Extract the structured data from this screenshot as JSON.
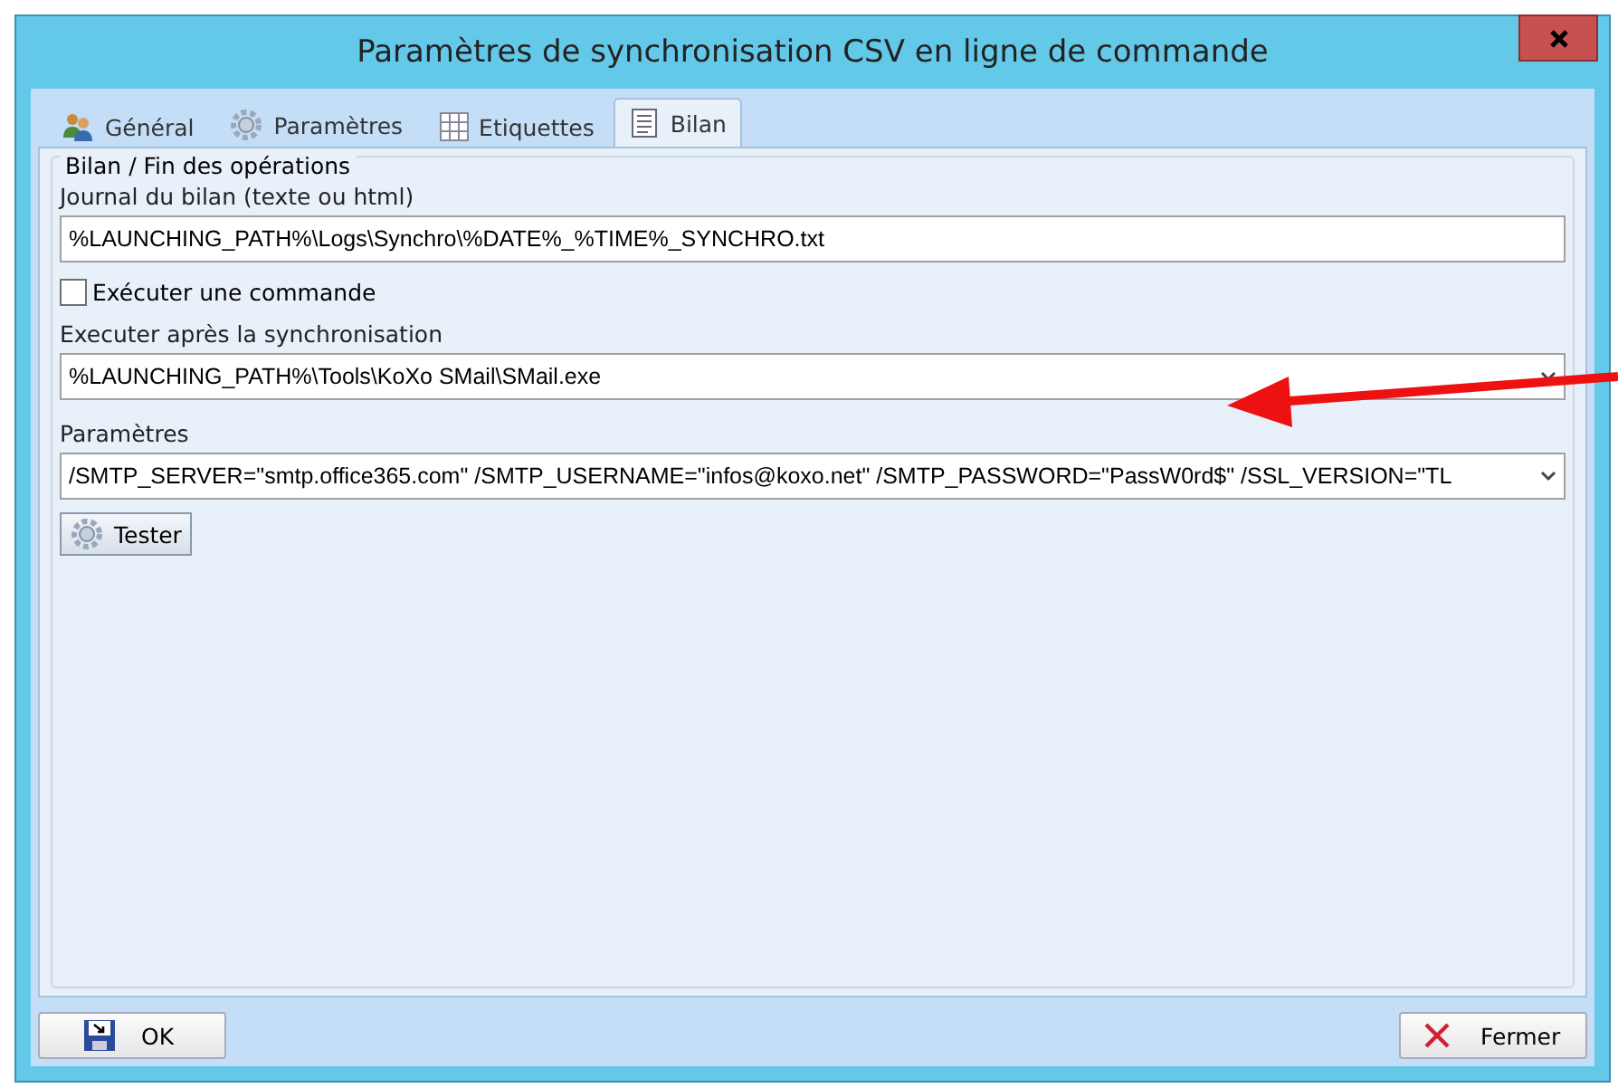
{
  "window": {
    "title": "Paramètres de synchronisation CSV en ligne de commande"
  },
  "tabs": [
    {
      "label": "Général",
      "kind": "users",
      "selected": false
    },
    {
      "label": "Paramètres",
      "kind": "gear",
      "selected": false
    },
    {
      "label": "Etiquettes",
      "kind": "grid",
      "selected": false
    },
    {
      "label": "Bilan",
      "kind": "doc",
      "selected": true
    }
  ],
  "group": {
    "title": "Bilan / Fin des opérations",
    "fields": [
      {
        "kind": "text",
        "label": "Journal du bilan (texte ou html)",
        "value": "%LAUNCHING_PATH%\\Logs\\Synchro\\%DATE%_%TIME%_SYNCHRO.txt"
      },
      {
        "kind": "checkbox",
        "label": "Exécuter une commande",
        "checked": false
      },
      {
        "kind": "combo",
        "label": "Executer après la synchronisation",
        "value": "%LAUNCHING_PATH%\\Tools\\KoXo SMail\\SMail.exe"
      },
      {
        "kind": "combo",
        "label": "Paramètres",
        "value": "/SMTP_SERVER=\"smtp.office365.com\" /SMTP_USERNAME=\"infos@koxo.net\" /SMTP_PASSWORD=\"PassW0rd$\" /SSL_VERSION=\"TL"
      }
    ],
    "button": "Tester"
  },
  "buttons": [
    {
      "label": "OK",
      "kind": "save"
    },
    {
      "label": "Fermer",
      "kind": "close"
    }
  ]
}
